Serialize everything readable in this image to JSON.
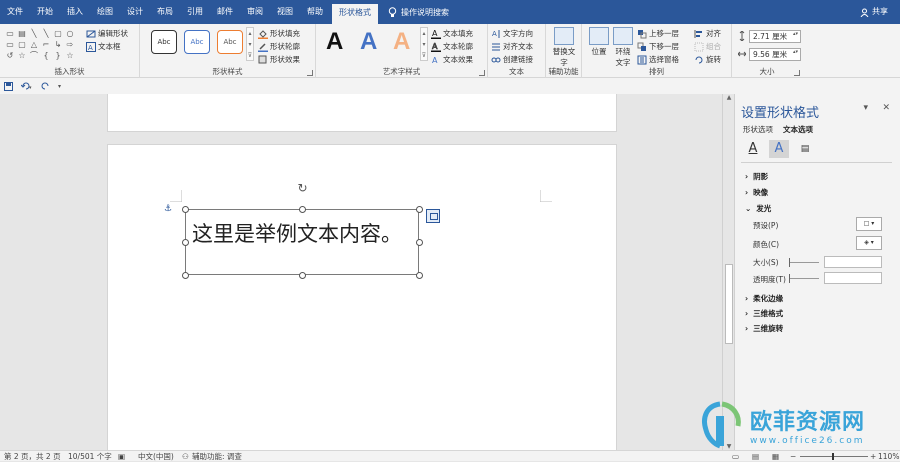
{
  "menubar": {
    "tabs": [
      "文件",
      "开始",
      "插入",
      "绘图",
      "设计",
      "布局",
      "引用",
      "邮件",
      "审阅",
      "视图",
      "帮助",
      "形状格式"
    ],
    "active_tab": "形状格式",
    "tell_me": "操作说明搜索",
    "share": "共享"
  },
  "ribbon": {
    "insert_shapes": {
      "edit_shape": "编辑形状",
      "text_box": "文本框",
      "label": "插入形状"
    },
    "shape_styles": {
      "samples": [
        "Abc",
        "Abc",
        "Abc"
      ],
      "fill": "形状填充",
      "outline": "形状轮廓",
      "effects": "形状效果",
      "label": "形状样式"
    },
    "wordart": {
      "samples": [
        "A",
        "A",
        "A"
      ],
      "text_fill": "文本填充",
      "text_outline": "文本轮廓",
      "text_effects": "文本效果",
      "label": "艺术字样式"
    },
    "text": {
      "direction": "文字方向",
      "align": "对齐文本",
      "link": "创建链接",
      "label": "文本"
    },
    "accessibility": {
      "alt_text": "替换文字",
      "label": "辅助功能"
    },
    "arrange": {
      "position": "位置",
      "wrap": "环绕文字",
      "forward": "上移一层",
      "backward": "下移一层",
      "selection": "选择窗格",
      "align": "对齐",
      "group": "组合",
      "rotate": "旋转",
      "label": "排列"
    },
    "size": {
      "height": "2.71 厘米",
      "width": "9.56 厘米",
      "label": "大小"
    }
  },
  "document": {
    "textbox_text": "这里是举例文本内容。"
  },
  "pane": {
    "title": "设置形状格式",
    "tabs": [
      "形状选项",
      "文本选项"
    ],
    "active_tab": "文本选项",
    "sections": {
      "shadow": "阴影",
      "reflection": "映像",
      "glow": "发光",
      "soft_edges": "柔化边缘",
      "format_3d": "三维格式",
      "rotation_3d": "三维旋转"
    },
    "glow_props": {
      "preset": "预设(P)",
      "color": "颜色(C)",
      "size": "大小(S)",
      "transparency": "透明度(T)"
    }
  },
  "status": {
    "page": "第 2 页，共 2 页",
    "words": "10/501 个字",
    "language": "中文(中国)",
    "accessibility": "辅助功能: 调查",
    "zoom": "110%"
  },
  "watermark": {
    "name": "欧菲资源网",
    "url": "www.office26.com"
  },
  "colors": {
    "accent": "#2b579a",
    "wordart_blue": "#4472c4",
    "wordart_orange": "#f4b183"
  }
}
